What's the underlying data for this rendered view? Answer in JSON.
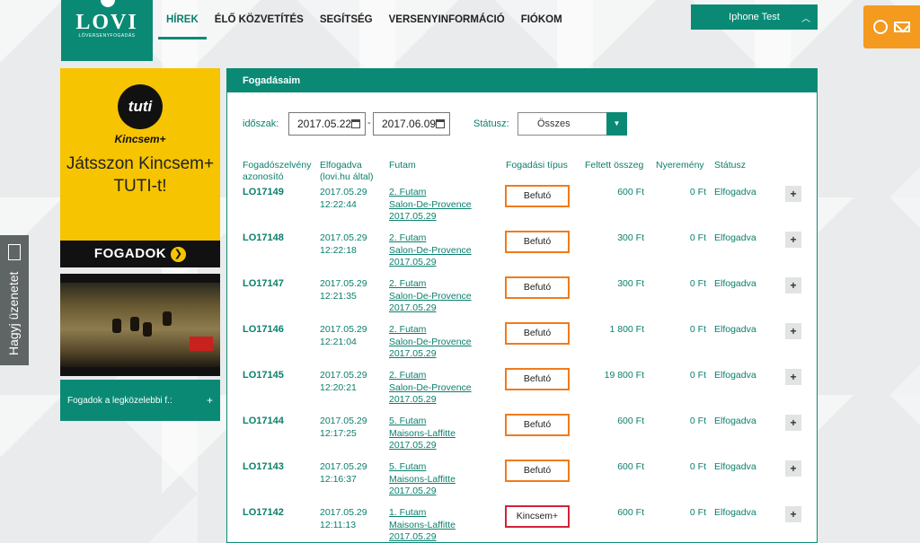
{
  "logo": {
    "name": "LOVI",
    "subtitle": "LÓVERSENYFOGADÁS"
  },
  "nav": [
    "HÍREK",
    "ÉLŐ KÖZVETÍTÉS",
    "SEGÍTSÉG",
    "VERSENYINFORMÁCIÓ",
    "FIÓKOM"
  ],
  "user": {
    "name": "Iphone Test"
  },
  "side_tab": {
    "label": "Hagyj üzenetet"
  },
  "ad": {
    "circle": "tuti",
    "brand": "Kincsem+",
    "text": "Játsszon Kincsem+ TUTI-t!",
    "cta": "FOGADOK"
  },
  "nearest": {
    "label": "Fogadok a legközelebbi f.:",
    "plus": "+"
  },
  "panel": {
    "title": "Fogadásaim",
    "period_label": "időszak:",
    "date_from": "2017.05.22",
    "date_to": "2017.06.09",
    "dash": "-",
    "status_label": "Státusz:",
    "status_value": "Összes"
  },
  "columns": {
    "id_line1": "Fogadószelvény",
    "id_line2": "azonosító",
    "accepted_line1": "Elfogadva",
    "accepted_line2": "(lovi.hu által)",
    "race": "Futam",
    "type": "Fogadási típus",
    "amount": "Feltett összeg",
    "win": "Nyeremény",
    "status": "Státusz"
  },
  "rows": [
    {
      "id": "LO17149",
      "date": "2017.05.29",
      "time": "12:22:44",
      "race1": "2. Futam",
      "race2": "Salon-De-Provence",
      "race3": "2017.05.29",
      "type": "Befutó",
      "amount": "600 Ft",
      "win": "0 Ft",
      "status": "Elfogadva",
      "plus": "+"
    },
    {
      "id": "LO17148",
      "date": "2017.05.29",
      "time": "12:22:18",
      "race1": "2. Futam",
      "race2": "Salon-De-Provence",
      "race3": "2017.05.29",
      "type": "Befutó",
      "amount": "300 Ft",
      "win": "0 Ft",
      "status": "Elfogadva",
      "plus": "+"
    },
    {
      "id": "LO17147",
      "date": "2017.05.29",
      "time": "12:21:35",
      "race1": "2. Futam",
      "race2": "Salon-De-Provence",
      "race3": "2017.05.29",
      "type": "Befutó",
      "amount": "300 Ft",
      "win": "0 Ft",
      "status": "Elfogadva",
      "plus": "+"
    },
    {
      "id": "LO17146",
      "date": "2017.05.29",
      "time": "12:21:04",
      "race1": "2. Futam",
      "race2": "Salon-De-Provence",
      "race3": "2017.05.29",
      "type": "Befutó",
      "amount": "1 800 Ft",
      "win": "0 Ft",
      "status": "Elfogadva",
      "plus": "+"
    },
    {
      "id": "LO17145",
      "date": "2017.05.29",
      "time": "12:20:21",
      "race1": "2. Futam",
      "race2": "Salon-De-Provence",
      "race3": "2017.05.29",
      "type": "Befutó",
      "amount": "19 800 Ft",
      "win": "0 Ft",
      "status": "Elfogadva",
      "plus": "+"
    },
    {
      "id": "LO17144",
      "date": "2017.05.29",
      "time": "12:17:25",
      "race1": "5. Futam",
      "race2": "Maisons-Laffitte",
      "race3": "2017.05.29",
      "type": "Befutó",
      "amount": "600 Ft",
      "win": "0 Ft",
      "status": "Elfogadva",
      "plus": "+"
    },
    {
      "id": "LO17143",
      "date": "2017.05.29",
      "time": "12:16:37",
      "race1": "5. Futam",
      "race2": "Maisons-Laffitte",
      "race3": "2017.05.29",
      "type": "Befutó",
      "amount": "600 Ft",
      "win": "0 Ft",
      "status": "Elfogadva",
      "plus": "+"
    },
    {
      "id": "LO17142",
      "date": "2017.05.29",
      "time": "12:11:13",
      "race1": "1. Futam",
      "race2": "Maisons-Laffitte",
      "race3": "2017.05.29",
      "type": "Kincsem+",
      "amount": "600 Ft",
      "win": "0 Ft",
      "status": "Elfogadva",
      "plus": "+"
    }
  ],
  "colors": {
    "accent": "#0a8a75",
    "befuto_border": "#f07b1c",
    "kincsem_border": "#d2233a",
    "notification": "#f39a1f",
    "ad_yellow": "#f6c400"
  },
  "icons": {
    "notification": [
      "timer-icon",
      "mail-icon"
    ],
    "side_tab": "envelope-icon",
    "date": "calendar-icon",
    "select": "caret-down-icon"
  }
}
